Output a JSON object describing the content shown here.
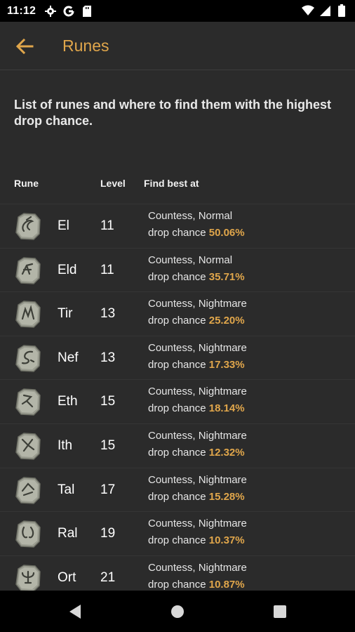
{
  "status_bar": {
    "time": "11:12"
  },
  "app_bar": {
    "title": "Runes"
  },
  "description": "List of runes and where to find them with the highest drop chance.",
  "table": {
    "headers": {
      "rune": "Rune",
      "level": "Level",
      "find": "Find best at"
    },
    "chance_prefix": "drop chance",
    "rows": [
      {
        "name": "El",
        "level": "11",
        "location": "Countess, Normal",
        "chance": "50.06%"
      },
      {
        "name": "Eld",
        "level": "11",
        "location": "Countess, Normal",
        "chance": "35.71%"
      },
      {
        "name": "Tir",
        "level": "13",
        "location": "Countess, Nightmare",
        "chance": "25.20%"
      },
      {
        "name": "Nef",
        "level": "13",
        "location": "Countess, Nightmare",
        "chance": "17.33%"
      },
      {
        "name": "Eth",
        "level": "15",
        "location": "Countess, Nightmare",
        "chance": "18.14%"
      },
      {
        "name": "Ith",
        "level": "15",
        "location": "Countess, Nightmare",
        "chance": "12.32%"
      },
      {
        "name": "Tal",
        "level": "17",
        "location": "Countess, Nightmare",
        "chance": "15.28%"
      },
      {
        "name": "Ral",
        "level": "19",
        "location": "Countess, Nightmare",
        "chance": "10.37%"
      },
      {
        "name": "Ort",
        "level": "21",
        "location": "Countess, Nightmare",
        "chance": "10.87%"
      }
    ]
  },
  "colors": {
    "accent": "#e0a64b",
    "background": "#2b2b2b",
    "bars": "#000000"
  }
}
